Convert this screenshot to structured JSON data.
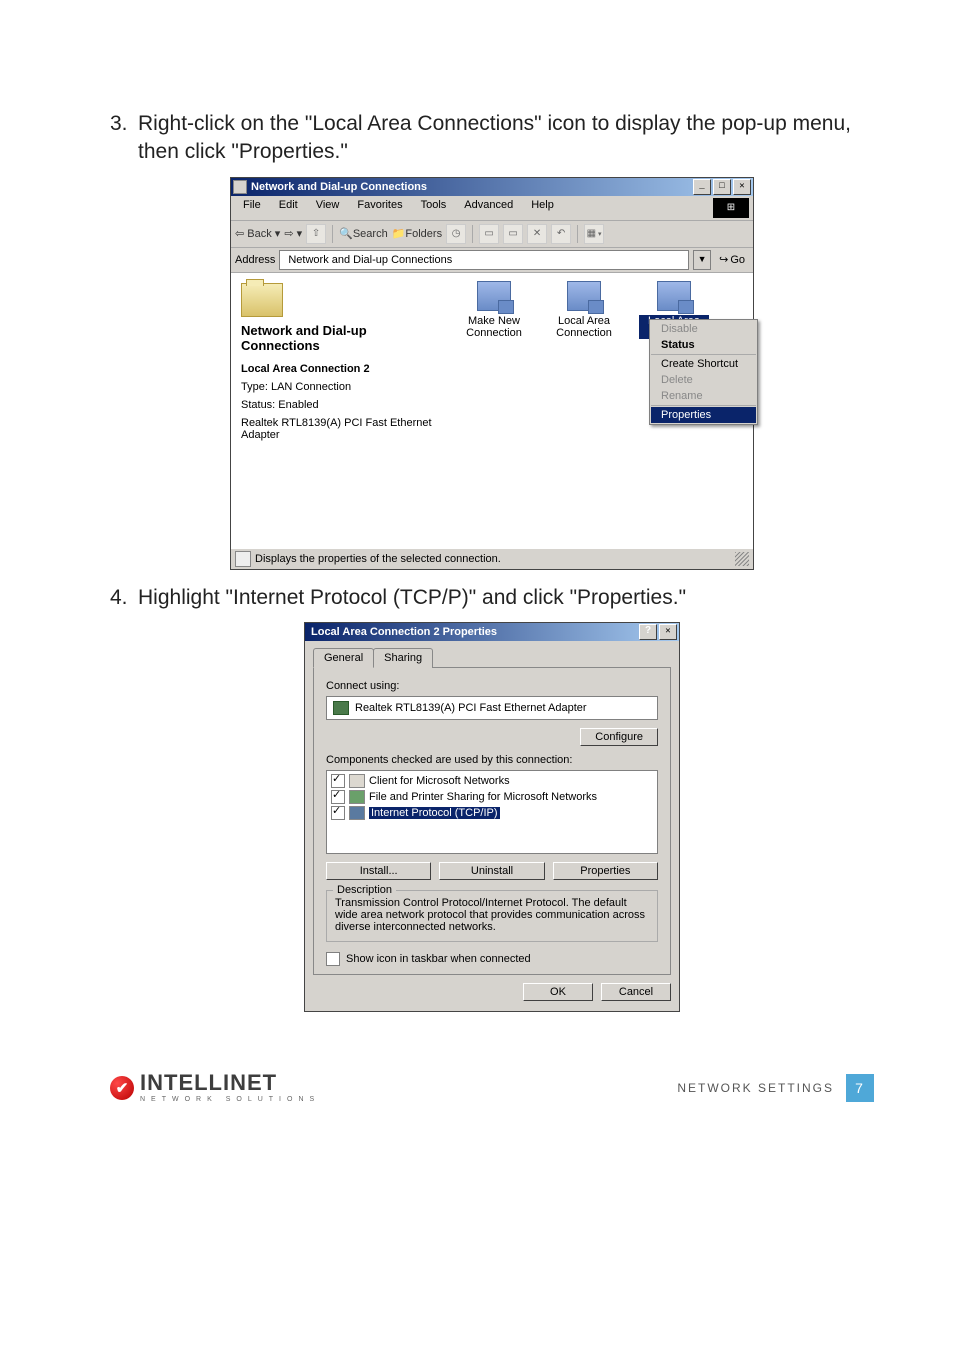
{
  "steps": {
    "s3_num": "3.",
    "s3": "Right-click on the \"Local Area Connections\" icon to display the pop-up menu, then click \"Properties.\"",
    "s4_num": "4.",
    "s4": "Highlight \"Internet Protocol (TCP/P)\" and click \"Properties.\""
  },
  "win1": {
    "title": "Network and Dial-up Connections",
    "min": "_",
    "max": "□",
    "close": "✕",
    "menu": {
      "file": "File",
      "edit": "Edit",
      "view": "View",
      "fav": "Favorites",
      "tools": "Tools",
      "adv": "Advanced",
      "help": "Help"
    },
    "toolbar": {
      "back": "Back",
      "search": "Search",
      "folders": "Folders"
    },
    "addr_label": "Address",
    "addr_value": "Network and Dial-up Connections",
    "go": "Go",
    "left": {
      "title": "Network and Dial-up Connections",
      "sub": "Local Area Connection 2",
      "type": "Type: LAN Connection",
      "status": "Status: Enabled",
      "adapter": "Realtek RTL8139(A) PCI Fast Ethernet Adapter"
    },
    "items": {
      "make": "Make New Connection",
      "lac": "Local Area Connection",
      "lac2": "Local Area Connecti"
    },
    "ctx": {
      "disable": "Disable",
      "status": "Status",
      "shortcut": "Create Shortcut",
      "delete": "Delete",
      "rename": "Rename",
      "props": "Properties"
    },
    "statusbar": "Displays the properties of the selected connection."
  },
  "win2": {
    "title": "Local Area Connection 2 Properties",
    "q": "?",
    "close": "✕",
    "tab_general": "General",
    "tab_sharing": "Sharing",
    "connect_using": "Connect using:",
    "adapter": "Realtek RTL8139(A) PCI Fast Ethernet Adapter",
    "configure": "Configure",
    "components_label": "Components checked are used by this connection:",
    "comp": {
      "client": "Client for Microsoft Networks",
      "share": "File and Printer Sharing for Microsoft Networks",
      "tcpip": "Internet Protocol (TCP/IP)"
    },
    "install": "Install...",
    "uninstall": "Uninstall",
    "properties": "Properties",
    "desc_legend": "Description",
    "desc": "Transmission Control Protocol/Internet Protocol. The default wide area network protocol that provides communication across diverse interconnected networks.",
    "show_icon": "Show icon in taskbar when connected",
    "ok": "OK",
    "cancel": "Cancel"
  },
  "footer": {
    "brand": "INTELLINET",
    "sub": "NETWORK SOLUTIONS",
    "label": "NETWORK SETTINGS",
    "page": "7"
  }
}
